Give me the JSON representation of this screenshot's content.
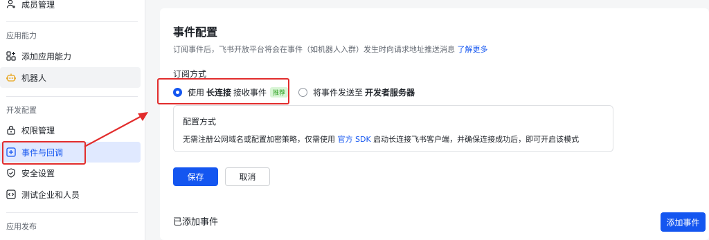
{
  "sidebar": {
    "member_management": "成员管理",
    "app_abilities_section": "应用能力",
    "add_app_ability": "添加应用能力",
    "bot": "机器人",
    "dev_config_section": "开发配置",
    "permission_management": "权限管理",
    "events_and_callbacks": "事件与回调",
    "security_settings": "安全设置",
    "test_enterprise_members": "测试企业和人员",
    "app_release_section": "应用发布"
  },
  "main": {
    "title": "事件配置",
    "description": "订阅事件后，飞书开放平台将会在事件（如机器人入群）发生时向请求地址推送消息",
    "learn_more": "了解更多",
    "subscription_method_label": "订阅方式",
    "option_long_connection": {
      "prefix": "使用",
      "bold": "长连接",
      "suffix": "接收事件",
      "badge": "推荐",
      "checked": true
    },
    "option_dev_server": {
      "prefix": "将事件发送至",
      "bold": "开发者服务器",
      "checked": false
    },
    "config_method": {
      "title": "配置方式",
      "text_prefix": "无需注册公网域名或配置加密策略，仅需使用",
      "link": "官方 SDK",
      "text_suffix": "启动长连接飞书客户端，并确保连接成功后，即可开启该模式"
    },
    "save_button": "保存",
    "cancel_button": "取消",
    "added_events_title": "已添加事件",
    "add_event_button": "添加事件"
  },
  "colors": {
    "accent": "#1456f0",
    "highlight": "#e22c2c",
    "badge_bg": "#d9f5d6",
    "badge_text": "#2ea121"
  }
}
